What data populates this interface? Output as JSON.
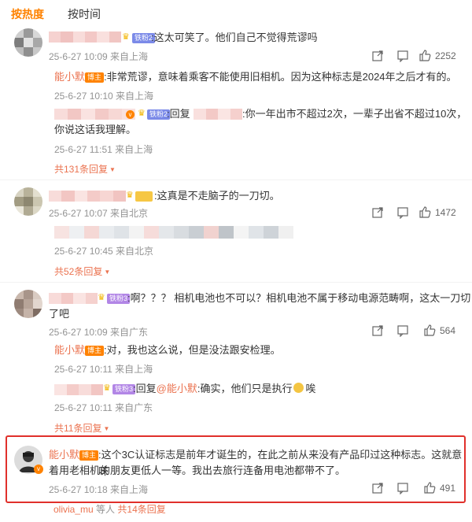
{
  "tabs": {
    "hot": "按热度",
    "time": "按时间"
  },
  "colors": {
    "accent": "#ff8200",
    "link": "#eb7350",
    "meta": "#939393",
    "highlight_box": "#e0302b"
  },
  "blogger_badge": "博主",
  "comments": [
    {
      "fan_badge": "铁粉2",
      "text": ":这太可笑了。他们自己不觉得荒谬吗",
      "meta": "25-6-27 10:09 来自上海",
      "likes": "2252",
      "replies": [
        {
          "name": "能小默",
          "text": ":非常荒谬，意味着乘客不能使用旧相机。因为这种标志是2024年之后才有的。",
          "meta": "25-6-27 10:10 来自上海"
        },
        {
          "fan_badge": "铁粉2",
          "reply_prefix": ":回复",
          "text_line1": ":你一年出市不超过2次，一辈子出省不超过10次，",
          "text_line2": "你说这话我理解。",
          "meta": "25-6-27 11:51 来自上海"
        }
      ],
      "reply_count": "共131条回复"
    },
    {
      "text": ":这真是不走脑子的一刀切。",
      "meta": "25-6-27 10:07 来自北京",
      "likes": "1472",
      "replies": [
        {
          "meta": "25-6-27 10:45 来自北京"
        }
      ],
      "reply_count": "共52条回复"
    },
    {
      "fan_badge": "铁粉3",
      "text_line1": ":啊？？？ 相机电池也不可以？相机电池不属于移动电源范畴啊，这太一刀切",
      "text_line2": "了吧",
      "meta": "25-6-27 10:09 来自广东",
      "likes": "564",
      "replies": [
        {
          "name": "能小默",
          "text": ":对，我也这么说，但是没法跟安检理。",
          "meta": "25-6-27 10:11 来自上海"
        },
        {
          "fan_badge": "铁粉3",
          "reply_prefix": ":回复",
          "mention": "@能小默",
          "text": ":确实，他们只是执行",
          "text_tail": "唉",
          "meta": "25-6-27 10:11 来自广东"
        }
      ],
      "reply_count": "共11条回复"
    },
    {
      "name": "能小默",
      "text_line1": ":这个3C认证标志是前年才诞生的，在此之前从来没有产品印过这种标志。这就意味",
      "text_line2": "着用老相机的朋友更低人一等。我出去旅行连备用电池都带不了。",
      "meta": "25-6-27 10:18 来自上海",
      "likes": "491"
    }
  ],
  "bottom": {
    "user": "olivia_mu",
    "suffix": "等人",
    "reply_count": "共14条回复"
  }
}
